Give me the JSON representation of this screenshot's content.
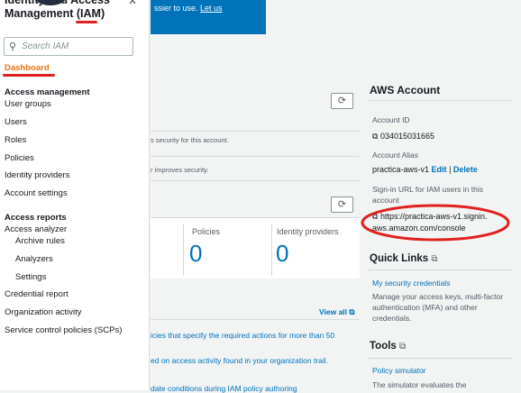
{
  "sidebar": {
    "title_line1": "Identity and Access",
    "title_line2": "Management (IAM)",
    "search_placeholder": "Search IAM",
    "items": {
      "dashboard": "Dashboard",
      "access_management": "Access management",
      "user_groups": "User groups",
      "users": "Users",
      "roles": "Roles",
      "policies": "Policies",
      "identity_providers": "Identity providers",
      "account_settings": "Account settings",
      "access_reports": "Access reports",
      "access_analyzer": "Access analyzer",
      "archive_rules": "Archive rules",
      "analyzers": "Analyzers",
      "settings": "Settings",
      "credential_report": "Credential report",
      "organization_activity": "Organization activity",
      "scps": "Service control policies (SCPs)"
    }
  },
  "banner": {
    "text": "ssier to use.",
    "link": "Let us"
  },
  "main": {
    "security_text_1": "s security for this account.",
    "security_text_2": "r improves security.",
    "metrics": [
      {
        "label": "Policies",
        "value": "0"
      },
      {
        "label": "Identity providers",
        "value": "0"
      }
    ],
    "view_all": "View all",
    "tasks": [
      "icies that specify the required actions for more than 50",
      "ed on access activity found in your organization trail.",
      "date conditions during IAM policy authoring"
    ]
  },
  "account": {
    "title": "AWS Account",
    "account_id_label": "Account ID",
    "account_id": "034015031665",
    "alias_label": "Account Alias",
    "alias": "practica-aws-v1",
    "edit": "Edit",
    "separator": "|",
    "delete": "Delete",
    "signin_label": "Sign-in URL for IAM users in this account",
    "signin_url_line1": "https://practica-aws-v1.signin.",
    "signin_url_line2": "aws.amazon.com/console"
  },
  "quick_links": {
    "title": "Quick Links",
    "link": "My security credentials",
    "desc": "Manage your access keys, multi-factor authentication (MFA) and other credentials."
  },
  "tools": {
    "title": "Tools",
    "link": "Policy simulator",
    "desc": "The simulator evaluates the"
  }
}
